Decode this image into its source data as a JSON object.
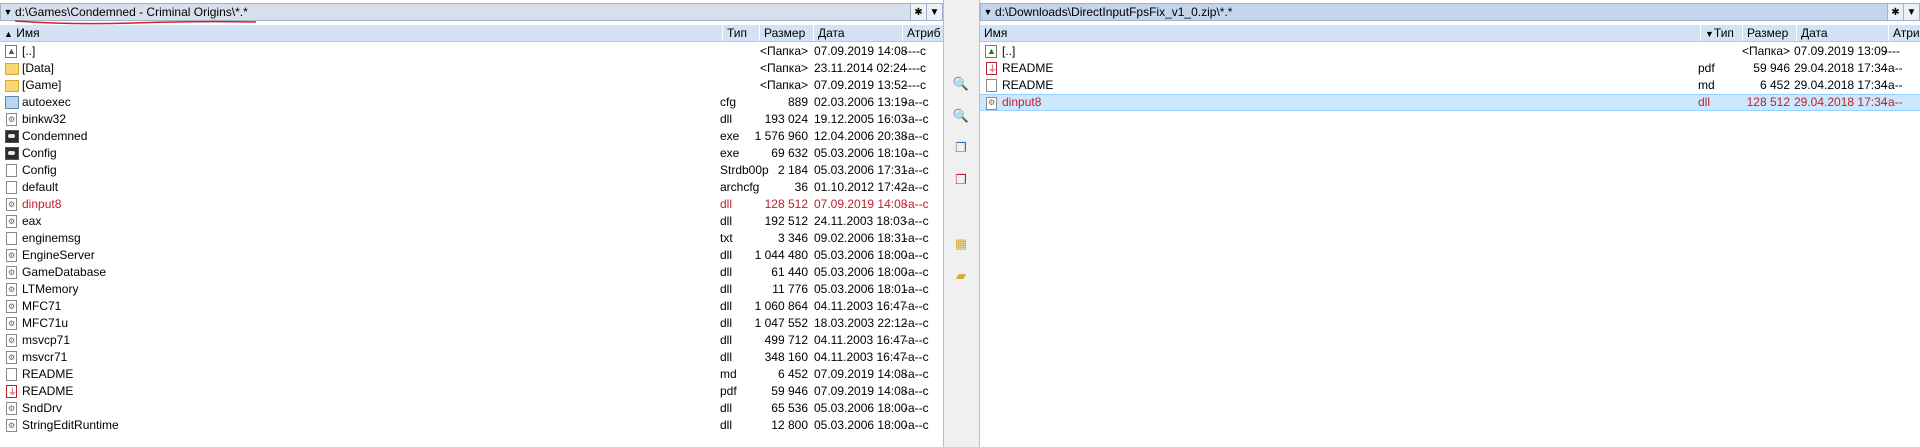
{
  "left": {
    "path_prefix": "d:\\Games\\",
    "path_highlight": "Condemned - Criminal Origins",
    "path_suffix": "\\*.*",
    "btn_star": "✱",
    "btn_down": "▼",
    "headers": {
      "name": "Имя",
      "type": "Тип",
      "size": "Размер",
      "date": "Дата",
      "attr": "Атриб"
    },
    "rows": [
      {
        "name": "[..]",
        "type": "",
        "size": "<Папка>",
        "date": "07.09.2019 14:08",
        "attr": "----c",
        "icon": "up"
      },
      {
        "name": "[Data]",
        "type": "",
        "size": "<Папка>",
        "date": "23.11.2014 02:24",
        "attr": "----c",
        "icon": "folder"
      },
      {
        "name": "[Game]",
        "type": "",
        "size": "<Папка>",
        "date": "07.09.2019 13:52",
        "attr": "----c",
        "icon": "folder"
      },
      {
        "name": "autoexec",
        "type": "cfg",
        "size": "889",
        "date": "02.03.2006 13:19",
        "attr": "-a--c",
        "icon": "cfg-file"
      },
      {
        "name": "binkw32",
        "type": "dll",
        "size": "193 024",
        "date": "19.12.2005 16:03",
        "attr": "-a--c",
        "icon": "dll-file"
      },
      {
        "name": "Condemned",
        "type": "exe",
        "size": "1 576 960",
        "date": "12.04.2006 20:38",
        "attr": "-a--c",
        "icon": "exe-file"
      },
      {
        "name": "Config",
        "type": "exe",
        "size": "69 632",
        "date": "05.03.2006 18:10",
        "attr": "-a--c",
        "icon": "exe-file"
      },
      {
        "name": "Config",
        "type": "Strdb00p",
        "size": "2 184",
        "date": "05.03.2006 17:31",
        "attr": "-a--c",
        "icon": "file"
      },
      {
        "name": "default",
        "type": "archcfg",
        "size": "36",
        "date": "01.10.2012 17:42",
        "attr": "-a--c",
        "icon": "file"
      },
      {
        "name": "dinput8",
        "type": "dll",
        "size": "128 512",
        "date": "07.09.2019 14:08",
        "attr": "-a--c",
        "icon": "dll-file",
        "red": true
      },
      {
        "name": "eax",
        "type": "dll",
        "size": "192 512",
        "date": "24.11.2003 18:03",
        "attr": "-a--c",
        "icon": "dll-file"
      },
      {
        "name": "enginemsg",
        "type": "txt",
        "size": "3 346",
        "date": "09.02.2006 18:31",
        "attr": "-a--c",
        "icon": "file"
      },
      {
        "name": "EngineServer",
        "type": "dll",
        "size": "1 044 480",
        "date": "05.03.2006 18:00",
        "attr": "-a--c",
        "icon": "dll-file"
      },
      {
        "name": "GameDatabase",
        "type": "dll",
        "size": "61 440",
        "date": "05.03.2006 18:00",
        "attr": "-a--c",
        "icon": "dll-file"
      },
      {
        "name": "LTMemory",
        "type": "dll",
        "size": "11 776",
        "date": "05.03.2006 18:01",
        "attr": "-a--c",
        "icon": "dll-file"
      },
      {
        "name": "MFC71",
        "type": "dll",
        "size": "1 060 864",
        "date": "04.11.2003 16:47",
        "attr": "-a--c",
        "icon": "dll-file"
      },
      {
        "name": "MFC71u",
        "type": "dll",
        "size": "1 047 552",
        "date": "18.03.2003 22:12",
        "attr": "-a--c",
        "icon": "dll-file"
      },
      {
        "name": "msvcp71",
        "type": "dll",
        "size": "499 712",
        "date": "04.11.2003 16:47",
        "attr": "-a--c",
        "icon": "dll-file"
      },
      {
        "name": "msvcr71",
        "type": "dll",
        "size": "348 160",
        "date": "04.11.2003 16:47",
        "attr": "-a--c",
        "icon": "dll-file"
      },
      {
        "name": "README",
        "type": "md",
        "size": "6 452",
        "date": "07.09.2019 14:08",
        "attr": "-a--c",
        "icon": "file"
      },
      {
        "name": "README",
        "type": "pdf",
        "size": "59 946",
        "date": "07.09.2019 14:08",
        "attr": "-a--c",
        "icon": "pdf-file"
      },
      {
        "name": "SndDrv",
        "type": "dll",
        "size": "65 536",
        "date": "05.03.2006 18:00",
        "attr": "-a--c",
        "icon": "dll-file"
      },
      {
        "name": "StringEditRuntime",
        "type": "dll",
        "size": "12 800",
        "date": "05.03.2006 18:00",
        "attr": "-a--c",
        "icon": "dll-file"
      }
    ]
  },
  "right": {
    "path": "d:\\Downloads\\DirectInputFpsFix_v1_0.zip\\*.*",
    "btn_star": "✱",
    "btn_down": "▼",
    "headers": {
      "name": "Имя",
      "type": "Тип",
      "size": "Размер",
      "date": "Дата",
      "attr": "Атриб"
    },
    "rows": [
      {
        "name": "[..]",
        "type": "",
        "size": "<Папка>",
        "date": "07.09.2019 13:09",
        "attr": "----",
        "icon": "up"
      },
      {
        "name": "README",
        "type": "pdf",
        "size": "59 946",
        "date": "29.04.2018 17:34",
        "attr": "-a--",
        "icon": "pdf-file"
      },
      {
        "name": "README",
        "type": "md",
        "size": "6 452",
        "date": "29.04.2018 17:34",
        "attr": "-a--",
        "icon": "file"
      },
      {
        "name": "dinput8",
        "type": "dll",
        "size": "128 512",
        "date": "29.04.2018 17:34",
        "attr": "-a--",
        "icon": "dll-file",
        "red": true,
        "selected": true
      }
    ]
  },
  "tools": [
    {
      "name": "search-icon",
      "glyph": "🔍"
    },
    {
      "name": "view-file-icon",
      "glyph": "🔍"
    },
    {
      "name": "copy-icon",
      "glyph": "❐"
    },
    {
      "name": "move-icon",
      "glyph": "❐"
    },
    {
      "name": "archive-icon",
      "glyph": "▦"
    },
    {
      "name": "new-folder-icon",
      "glyph": "▰"
    }
  ],
  "colors": {
    "red_text": "#c0202a",
    "header_bg": "#d3e2f4",
    "selection_bg": "#cce8ff"
  }
}
